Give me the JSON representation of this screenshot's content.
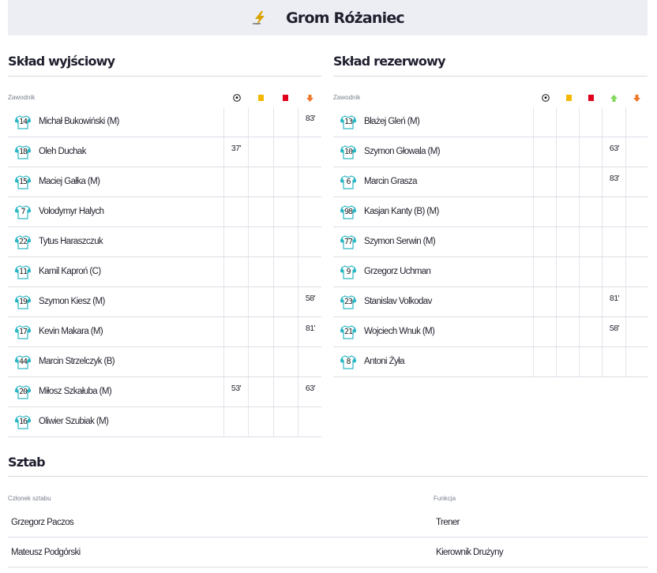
{
  "team": {
    "name": "Grom Różaniec",
    "logo_icon": "lightning-bolt-logo"
  },
  "starting": {
    "title": "Skład wyjściowy",
    "col_player": "Zawodnik",
    "icons": [
      "ball-icon",
      "yellow-card-icon",
      "red-card-icon",
      "sub-out-icon"
    ],
    "players": [
      {
        "num": "14",
        "name": "Michał Bukowiński (M)",
        "goal": "",
        "yellow": "",
        "red": "",
        "out": "83'"
      },
      {
        "num": "18",
        "name": "Oleh Duchak",
        "goal": "37'",
        "yellow": "",
        "red": "",
        "out": ""
      },
      {
        "num": "15",
        "name": "Maciej Gałka (M)",
        "goal": "",
        "yellow": "",
        "red": "",
        "out": ""
      },
      {
        "num": "7",
        "name": "Volodymyr Halych",
        "goal": "",
        "yellow": "",
        "red": "",
        "out": ""
      },
      {
        "num": "22",
        "name": "Tytus Haraszczuk",
        "goal": "",
        "yellow": "",
        "red": "",
        "out": ""
      },
      {
        "num": "11",
        "name": "Kamil Kaproń (C)",
        "goal": "",
        "yellow": "",
        "red": "",
        "out": ""
      },
      {
        "num": "19",
        "name": "Szymon Kiesz (M)",
        "goal": "",
        "yellow": "",
        "red": "",
        "out": "58'"
      },
      {
        "num": "17",
        "name": "Kevin Makara (M)",
        "goal": "",
        "yellow": "",
        "red": "",
        "out": "81'"
      },
      {
        "num": "44",
        "name": "Marcin Strzelczyk (B)",
        "goal": "",
        "yellow": "",
        "red": "",
        "out": ""
      },
      {
        "num": "20",
        "name": "Miłosz Szkałuba (M)",
        "goal": "53'",
        "yellow": "",
        "red": "",
        "out": "63'"
      },
      {
        "num": "16",
        "name": "Oliwier Szubiak (M)",
        "goal": "",
        "yellow": "",
        "red": "",
        "out": ""
      }
    ]
  },
  "reserve": {
    "title": "Skład rezerwowy",
    "col_player": "Zawodnik",
    "icons": [
      "ball-icon",
      "yellow-card-icon",
      "red-card-icon",
      "sub-in-icon",
      "sub-out-icon"
    ],
    "players": [
      {
        "num": "13",
        "name": "Błażej Gleń (M)",
        "goal": "",
        "yellow": "",
        "red": "",
        "in": "",
        "out": ""
      },
      {
        "num": "10",
        "name": "Szymon Głowala (M)",
        "goal": "",
        "yellow": "",
        "red": "",
        "in": "63'",
        "out": ""
      },
      {
        "num": "6",
        "name": "Marcin Grasza",
        "goal": "",
        "yellow": "",
        "red": "",
        "in": "83'",
        "out": ""
      },
      {
        "num": "98",
        "name": "Kasjan Kanty (B) (M)",
        "goal": "",
        "yellow": "",
        "red": "",
        "in": "",
        "out": ""
      },
      {
        "num": "77",
        "name": "Szymon Serwin (M)",
        "goal": "",
        "yellow": "",
        "red": "",
        "in": "",
        "out": ""
      },
      {
        "num": "9",
        "name": "Grzegorz Uchman",
        "goal": "",
        "yellow": "",
        "red": "",
        "in": "",
        "out": ""
      },
      {
        "num": "23",
        "name": "Stanislav Volkodav",
        "goal": "",
        "yellow": "",
        "red": "",
        "in": "81'",
        "out": ""
      },
      {
        "num": "21",
        "name": "Wojciech Wnuk (M)",
        "goal": "",
        "yellow": "",
        "red": "",
        "in": "58'",
        "out": ""
      },
      {
        "num": "8",
        "name": "Antoni Żyła",
        "goal": "",
        "yellow": "",
        "red": "",
        "in": "",
        "out": ""
      }
    ]
  },
  "staff": {
    "title": "Sztab",
    "col_member": "Członek sztabu",
    "col_role": "Funkcja",
    "members": [
      {
        "name": "Grzegorz Paczos",
        "role": "Trener"
      },
      {
        "name": "Mateusz Podgórski",
        "role": "Kierownik Drużyny"
      }
    ]
  },
  "colors": {
    "yellow_card": "#f5b800",
    "red_card": "#e0001b",
    "sub_in": "#7ed957",
    "sub_out": "#f0782a",
    "shirt_teal": "#2cb7c4"
  }
}
